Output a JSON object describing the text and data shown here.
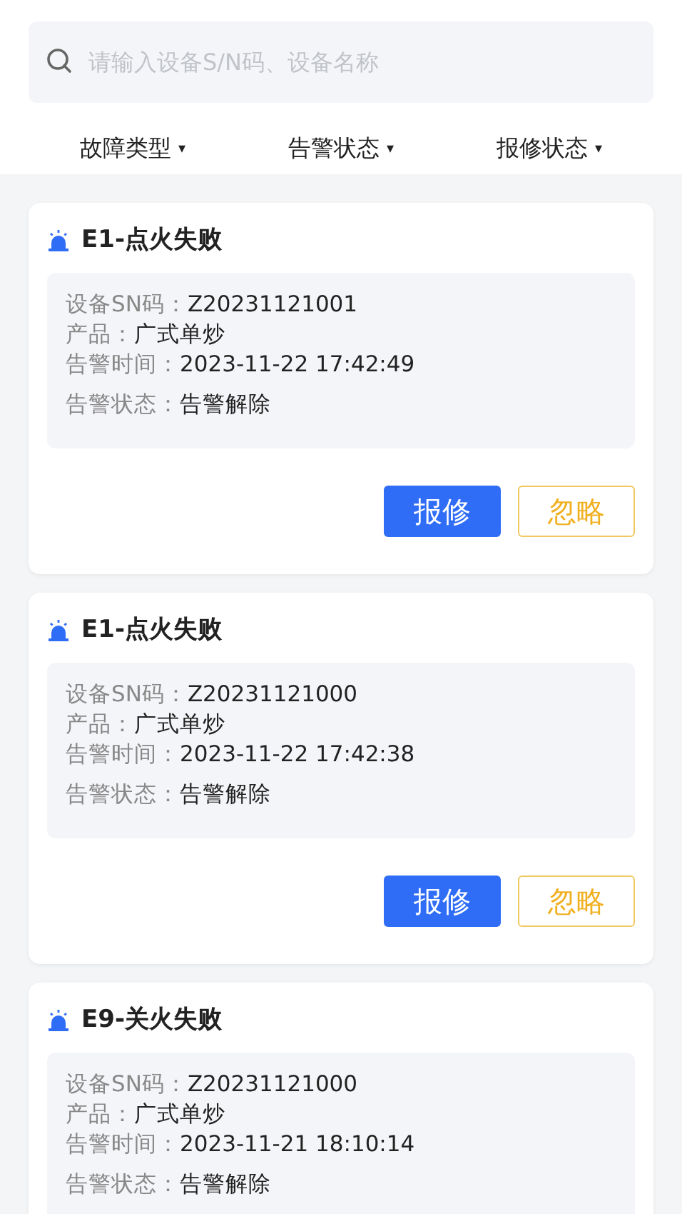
{
  "search": {
    "placeholder": "请输入设备S/N码、设备名称"
  },
  "filters": [
    {
      "label": "故障类型",
      "caret": "▾"
    },
    {
      "label": "告警状态",
      "caret": "▾"
    },
    {
      "label": "报修状态",
      "caret": "▾"
    }
  ],
  "alarms": [
    {
      "title": "E1-点火失败",
      "fields": [
        {
          "label": "设备SN码：",
          "value": "Z20231121001"
        },
        {
          "label": "产品：",
          "value": "广式单炒"
        },
        {
          "label": "告警时间：",
          "value": "2023-11-22 17:42:49"
        },
        {
          "label": "告警状态：",
          "value": "告警解除"
        }
      ],
      "buttons": [
        {
          "label": "报修",
          "kind": "primary"
        },
        {
          "label": "忽略",
          "kind": "outline"
        }
      ]
    },
    {
      "title": "E1-点火失败",
      "fields": [
        {
          "label": "设备SN码：",
          "value": "Z20231121000"
        },
        {
          "label": "产品：",
          "value": "广式单炒"
        },
        {
          "label": "告警时间：",
          "value": "2023-11-22 17:42:38"
        },
        {
          "label": "告警状态：",
          "value": "告警解除"
        }
      ],
      "buttons": [
        {
          "label": "报修",
          "kind": "primary"
        },
        {
          "label": "忽略",
          "kind": "outline"
        }
      ]
    },
    {
      "title": "E9-关火失败",
      "fields": [
        {
          "label": "设备SN码：",
          "value": "Z20231121000"
        },
        {
          "label": "产品：",
          "value": "广式单炒"
        },
        {
          "label": "告警时间：",
          "value": "2023-11-21 18:10:14"
        },
        {
          "label": "告警状态：",
          "value": "告警解除"
        }
      ]
    }
  ]
}
